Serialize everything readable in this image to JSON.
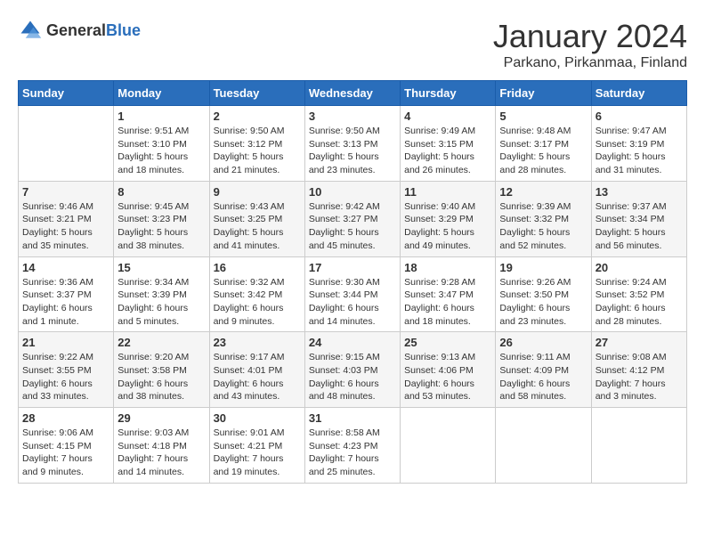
{
  "header": {
    "logo": {
      "text_general": "General",
      "text_blue": "Blue"
    },
    "title": "January 2024",
    "location": "Parkano, Pirkanmaa, Finland"
  },
  "weekdays": [
    "Sunday",
    "Monday",
    "Tuesday",
    "Wednesday",
    "Thursday",
    "Friday",
    "Saturday"
  ],
  "weeks": [
    [
      {
        "day": "",
        "sunrise": "",
        "sunset": "",
        "daylight": ""
      },
      {
        "day": "1",
        "sunrise": "Sunrise: 9:51 AM",
        "sunset": "Sunset: 3:10 PM",
        "daylight": "Daylight: 5 hours and 18 minutes."
      },
      {
        "day": "2",
        "sunrise": "Sunrise: 9:50 AM",
        "sunset": "Sunset: 3:12 PM",
        "daylight": "Daylight: 5 hours and 21 minutes."
      },
      {
        "day": "3",
        "sunrise": "Sunrise: 9:50 AM",
        "sunset": "Sunset: 3:13 PM",
        "daylight": "Daylight: 5 hours and 23 minutes."
      },
      {
        "day": "4",
        "sunrise": "Sunrise: 9:49 AM",
        "sunset": "Sunset: 3:15 PM",
        "daylight": "Daylight: 5 hours and 26 minutes."
      },
      {
        "day": "5",
        "sunrise": "Sunrise: 9:48 AM",
        "sunset": "Sunset: 3:17 PM",
        "daylight": "Daylight: 5 hours and 28 minutes."
      },
      {
        "day": "6",
        "sunrise": "Sunrise: 9:47 AM",
        "sunset": "Sunset: 3:19 PM",
        "daylight": "Daylight: 5 hours and 31 minutes."
      }
    ],
    [
      {
        "day": "7",
        "sunrise": "Sunrise: 9:46 AM",
        "sunset": "Sunset: 3:21 PM",
        "daylight": "Daylight: 5 hours and 35 minutes."
      },
      {
        "day": "8",
        "sunrise": "Sunrise: 9:45 AM",
        "sunset": "Sunset: 3:23 PM",
        "daylight": "Daylight: 5 hours and 38 minutes."
      },
      {
        "day": "9",
        "sunrise": "Sunrise: 9:43 AM",
        "sunset": "Sunset: 3:25 PM",
        "daylight": "Daylight: 5 hours and 41 minutes."
      },
      {
        "day": "10",
        "sunrise": "Sunrise: 9:42 AM",
        "sunset": "Sunset: 3:27 PM",
        "daylight": "Daylight: 5 hours and 45 minutes."
      },
      {
        "day": "11",
        "sunrise": "Sunrise: 9:40 AM",
        "sunset": "Sunset: 3:29 PM",
        "daylight": "Daylight: 5 hours and 49 minutes."
      },
      {
        "day": "12",
        "sunrise": "Sunrise: 9:39 AM",
        "sunset": "Sunset: 3:32 PM",
        "daylight": "Daylight: 5 hours and 52 minutes."
      },
      {
        "day": "13",
        "sunrise": "Sunrise: 9:37 AM",
        "sunset": "Sunset: 3:34 PM",
        "daylight": "Daylight: 5 hours and 56 minutes."
      }
    ],
    [
      {
        "day": "14",
        "sunrise": "Sunrise: 9:36 AM",
        "sunset": "Sunset: 3:37 PM",
        "daylight": "Daylight: 6 hours and 1 minute."
      },
      {
        "day": "15",
        "sunrise": "Sunrise: 9:34 AM",
        "sunset": "Sunset: 3:39 PM",
        "daylight": "Daylight: 6 hours and 5 minutes."
      },
      {
        "day": "16",
        "sunrise": "Sunrise: 9:32 AM",
        "sunset": "Sunset: 3:42 PM",
        "daylight": "Daylight: 6 hours and 9 minutes."
      },
      {
        "day": "17",
        "sunrise": "Sunrise: 9:30 AM",
        "sunset": "Sunset: 3:44 PM",
        "daylight": "Daylight: 6 hours and 14 minutes."
      },
      {
        "day": "18",
        "sunrise": "Sunrise: 9:28 AM",
        "sunset": "Sunset: 3:47 PM",
        "daylight": "Daylight: 6 hours and 18 minutes."
      },
      {
        "day": "19",
        "sunrise": "Sunrise: 9:26 AM",
        "sunset": "Sunset: 3:50 PM",
        "daylight": "Daylight: 6 hours and 23 minutes."
      },
      {
        "day": "20",
        "sunrise": "Sunrise: 9:24 AM",
        "sunset": "Sunset: 3:52 PM",
        "daylight": "Daylight: 6 hours and 28 minutes."
      }
    ],
    [
      {
        "day": "21",
        "sunrise": "Sunrise: 9:22 AM",
        "sunset": "Sunset: 3:55 PM",
        "daylight": "Daylight: 6 hours and 33 minutes."
      },
      {
        "day": "22",
        "sunrise": "Sunrise: 9:20 AM",
        "sunset": "Sunset: 3:58 PM",
        "daylight": "Daylight: 6 hours and 38 minutes."
      },
      {
        "day": "23",
        "sunrise": "Sunrise: 9:17 AM",
        "sunset": "Sunset: 4:01 PM",
        "daylight": "Daylight: 6 hours and 43 minutes."
      },
      {
        "day": "24",
        "sunrise": "Sunrise: 9:15 AM",
        "sunset": "Sunset: 4:03 PM",
        "daylight": "Daylight: 6 hours and 48 minutes."
      },
      {
        "day": "25",
        "sunrise": "Sunrise: 9:13 AM",
        "sunset": "Sunset: 4:06 PM",
        "daylight": "Daylight: 6 hours and 53 minutes."
      },
      {
        "day": "26",
        "sunrise": "Sunrise: 9:11 AM",
        "sunset": "Sunset: 4:09 PM",
        "daylight": "Daylight: 6 hours and 58 minutes."
      },
      {
        "day": "27",
        "sunrise": "Sunrise: 9:08 AM",
        "sunset": "Sunset: 4:12 PM",
        "daylight": "Daylight: 7 hours and 3 minutes."
      }
    ],
    [
      {
        "day": "28",
        "sunrise": "Sunrise: 9:06 AM",
        "sunset": "Sunset: 4:15 PM",
        "daylight": "Daylight: 7 hours and 9 minutes."
      },
      {
        "day": "29",
        "sunrise": "Sunrise: 9:03 AM",
        "sunset": "Sunset: 4:18 PM",
        "daylight": "Daylight: 7 hours and 14 minutes."
      },
      {
        "day": "30",
        "sunrise": "Sunrise: 9:01 AM",
        "sunset": "Sunset: 4:21 PM",
        "daylight": "Daylight: 7 hours and 19 minutes."
      },
      {
        "day": "31",
        "sunrise": "Sunrise: 8:58 AM",
        "sunset": "Sunset: 4:23 PM",
        "daylight": "Daylight: 7 hours and 25 minutes."
      },
      {
        "day": "",
        "sunrise": "",
        "sunset": "",
        "daylight": ""
      },
      {
        "day": "",
        "sunrise": "",
        "sunset": "",
        "daylight": ""
      },
      {
        "day": "",
        "sunrise": "",
        "sunset": "",
        "daylight": ""
      }
    ]
  ]
}
